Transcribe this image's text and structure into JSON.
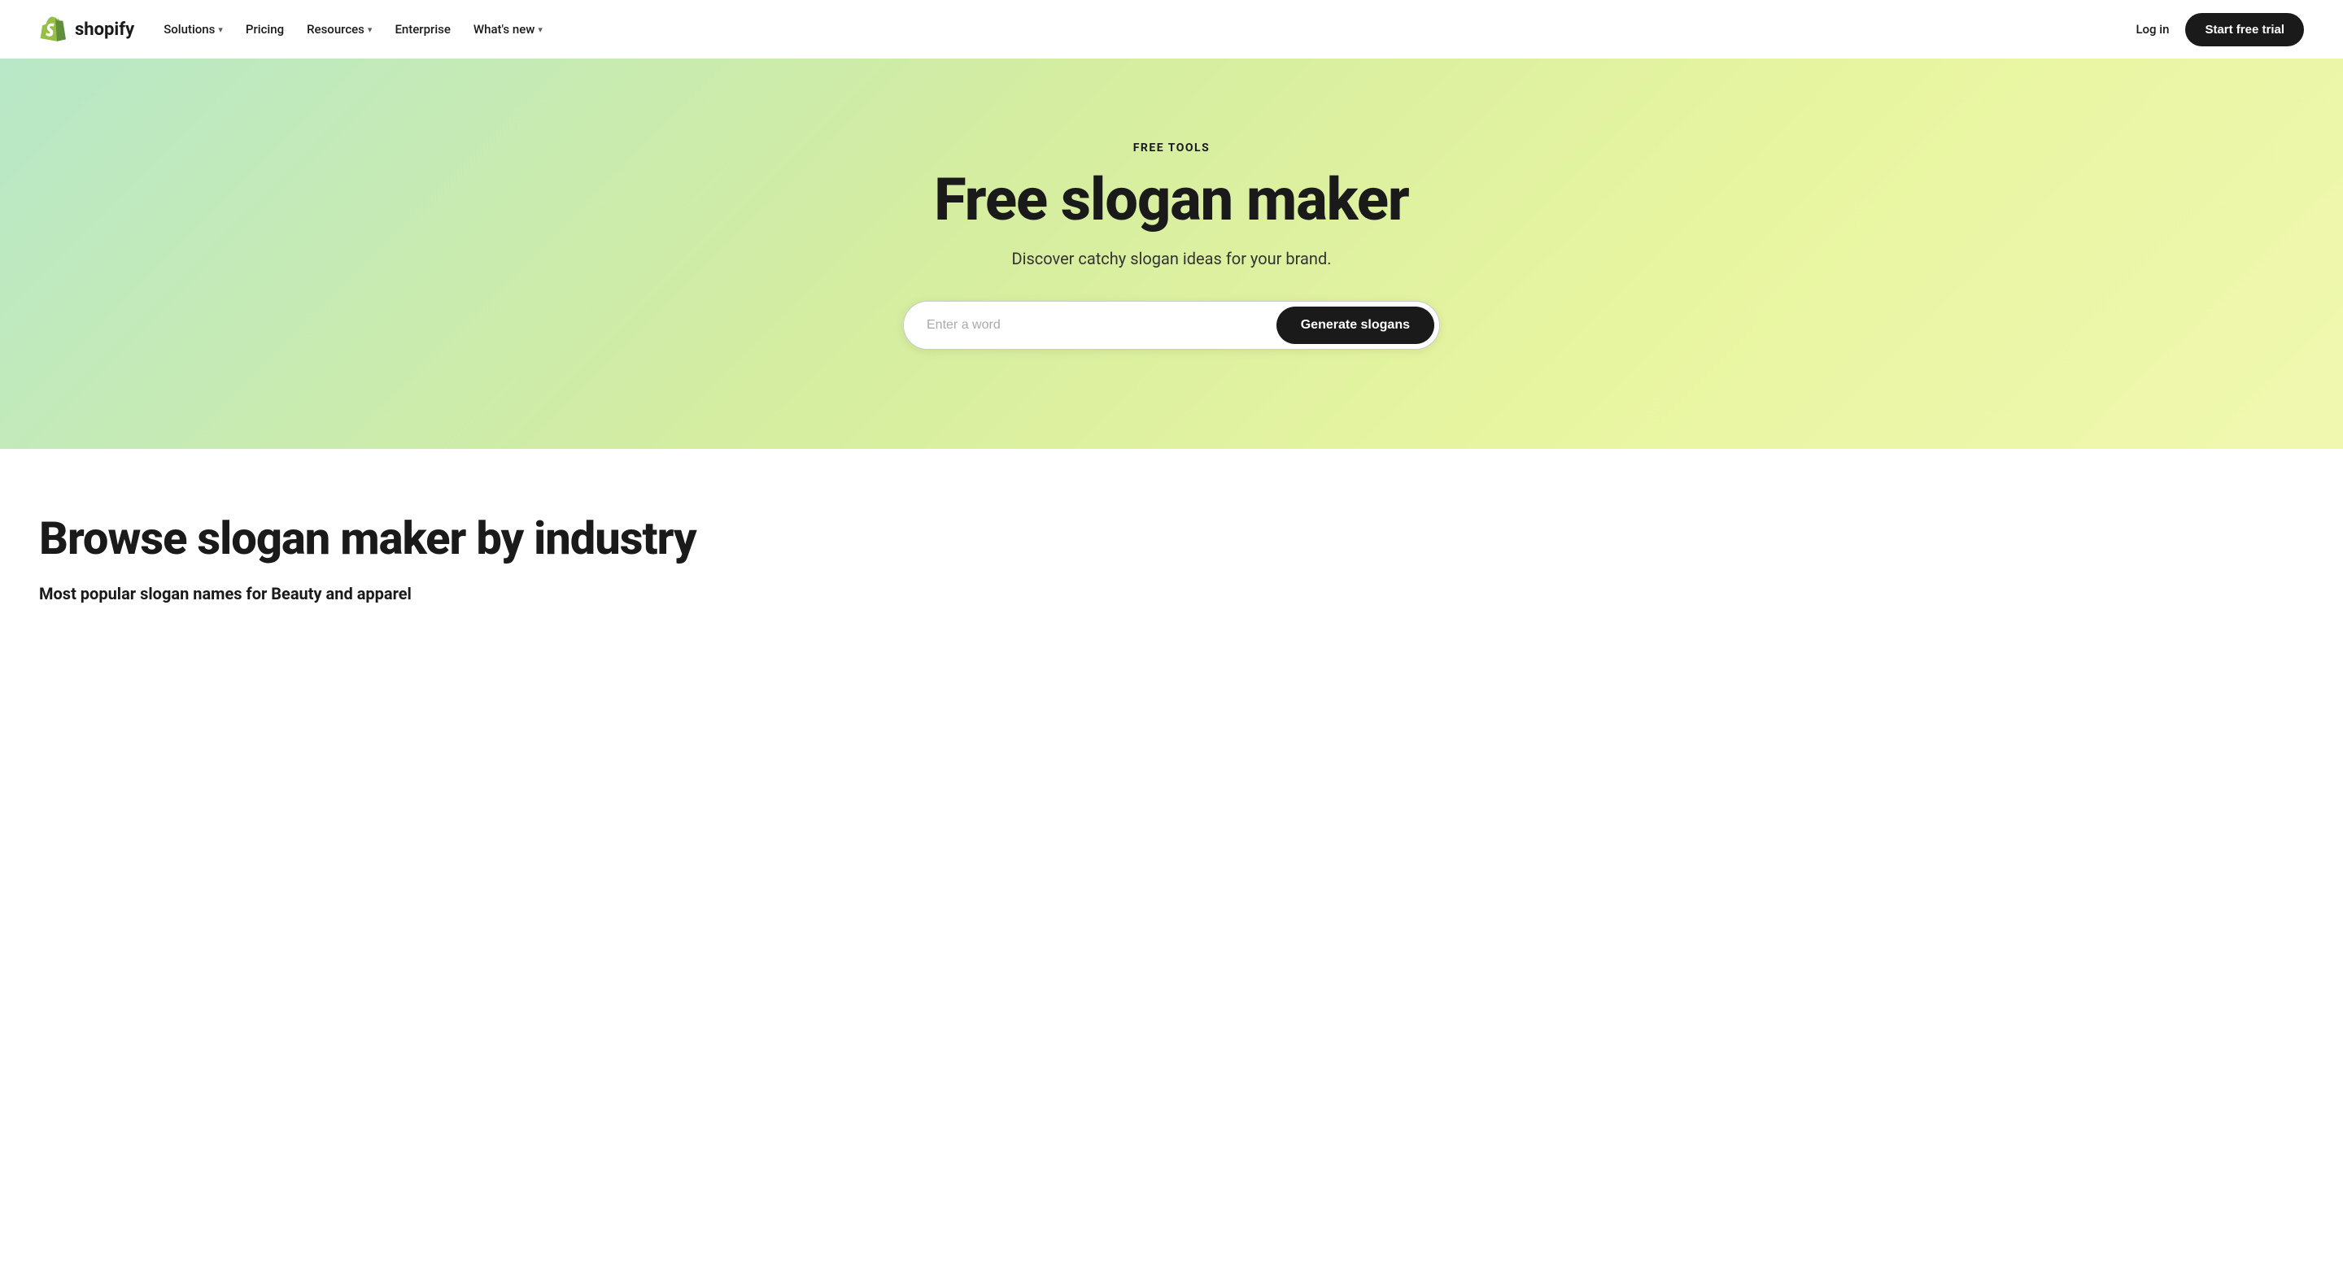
{
  "nav": {
    "logo_text": "shopify",
    "links": [
      {
        "label": "Solutions",
        "has_dropdown": true
      },
      {
        "label": "Pricing",
        "has_dropdown": false
      },
      {
        "label": "Resources",
        "has_dropdown": true
      },
      {
        "label": "Enterprise",
        "has_dropdown": false
      },
      {
        "label": "What's new",
        "has_dropdown": true
      }
    ],
    "login_label": "Log in",
    "start_trial_label": "Start free trial"
  },
  "hero": {
    "eyebrow": "FREE TOOLS",
    "title": "Free slogan maker",
    "subtitle": "Discover catchy slogan ideas for your brand.",
    "input_placeholder": "Enter a word",
    "generate_button_label": "Generate slogans"
  },
  "browse": {
    "title": "Browse slogan maker by industry",
    "subtitle": "Most popular slogan names for Beauty and apparel"
  }
}
